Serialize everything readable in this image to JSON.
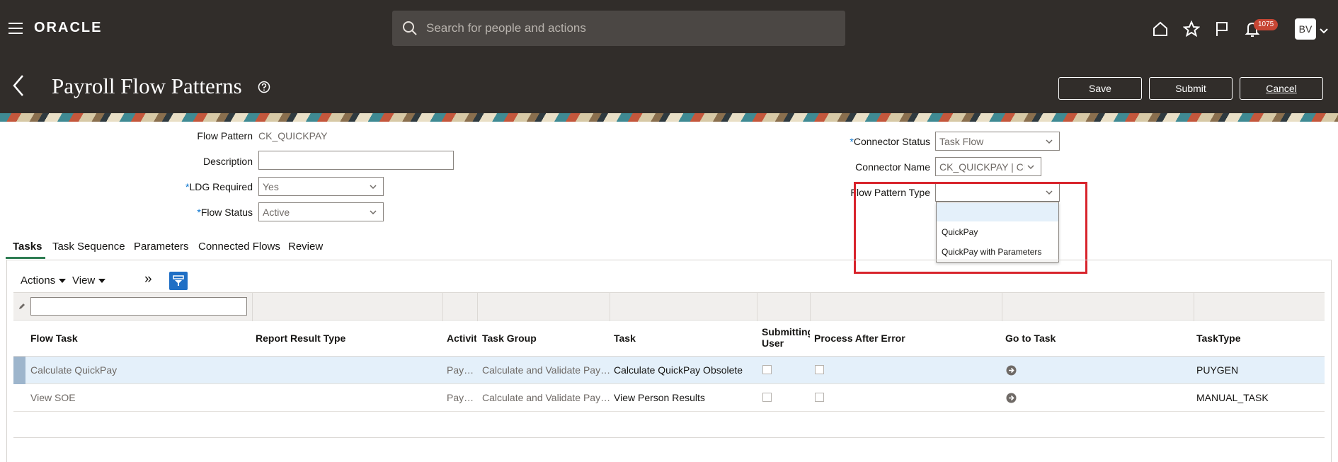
{
  "app": {
    "logo_text": "ORACLE",
    "search_placeholder": "Search for people and actions",
    "notification_count": "1075",
    "user_initials": "BV"
  },
  "page": {
    "title": "Payroll Flow Patterns",
    "buttons": {
      "save": "Save",
      "submit": "Submit",
      "cancel": "Cancel"
    }
  },
  "form": {
    "flow_pattern": {
      "label": "Flow Pattern",
      "value": "CK_QUICKPAY"
    },
    "description": {
      "label": "Description",
      "value": ""
    },
    "ldg_required": {
      "label": "LDG Required",
      "value": "Yes",
      "required_mark": "*"
    },
    "flow_status": {
      "label": "Flow Status",
      "value": "Active",
      "required_mark": "*"
    },
    "connector_status": {
      "label": "Connector Status",
      "value": "Task Flow",
      "required_mark": "*"
    },
    "connector_name": {
      "label": "Connector Name",
      "value": "CK_QUICKPAY | CK_QU"
    },
    "flow_pattern_type": {
      "label": "Flow Pattern Type",
      "value": "",
      "options": [
        "",
        "QuickPay",
        "QuickPay with Parameters"
      ]
    }
  },
  "tabs": [
    "Tasks",
    "Task Sequence",
    "Parameters",
    "Connected Flows",
    "Review"
  ],
  "toolbar": {
    "actions": "Actions",
    "view": "View",
    "more": "»"
  },
  "table": {
    "columns": [
      "Flow Task",
      "Report Result Type",
      "Activit",
      "Task Group",
      "Task",
      "Submitting User",
      "Process After Error",
      "Go to Task",
      "TaskType"
    ],
    "submitting_line1": "Submitting",
    "submitting_line2": "User",
    "rows": [
      {
        "flow_task": "Calculate QuickPay",
        "report_result_type": "",
        "activity": "Pay…",
        "task_group": "Calculate and Validate Pay…",
        "task": "Calculate QuickPay Obsolete",
        "task_type": "PUYGEN"
      },
      {
        "flow_task": "View SOE",
        "report_result_type": "",
        "activity": "Pay…",
        "task_group": "Calculate and Validate Pay…",
        "task": "View Person Results",
        "task_type": "MANUAL_TASK"
      }
    ]
  },
  "colors": {
    "header_bg": "#312d2a",
    "accent": "#1f6fc5",
    "highlight": "#d8242c",
    "tab_active": "#2e7d53"
  }
}
